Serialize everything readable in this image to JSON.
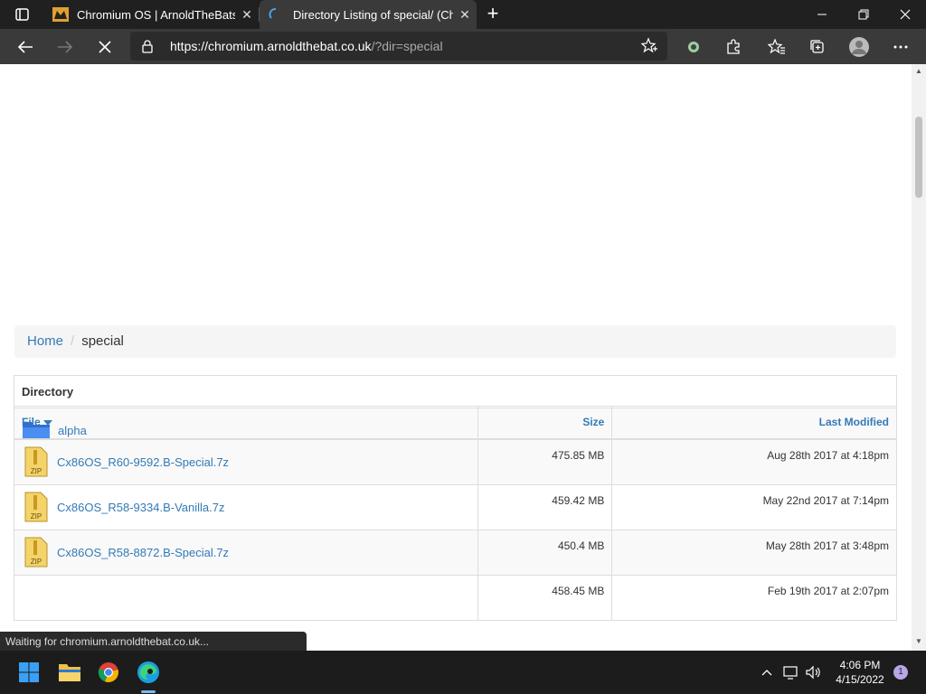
{
  "tabs": [
    {
      "title": "Chromium OS | ArnoldTheBats W",
      "close": "✕"
    },
    {
      "title": "Directory Listing of special/ (Chro",
      "close": "✕"
    }
  ],
  "new_tab": "+",
  "window": {
    "minimize": "—",
    "restore": "❐",
    "close": "✕"
  },
  "address": {
    "host": "https://chromium.arnoldthebat.co.uk",
    "rest": "/?dir=special"
  },
  "breadcrumb": {
    "home": "Home",
    "separator": "/",
    "current": "special"
  },
  "directory": {
    "heading": "Directory",
    "items": [
      {
        "name": "alpha"
      }
    ]
  },
  "files": {
    "headers": {
      "file": "File",
      "size": "Size",
      "modified": "Last Modified"
    },
    "rows": [
      {
        "name": "Cx86OS_R60-9592.B-Special.7z",
        "size": "475.85 MB",
        "modified": "Aug 28th 2017 at 4:18pm"
      },
      {
        "name": "Cx86OS_R58-9334.B-Vanilla.7z",
        "size": "459.42 MB",
        "modified": "May 22nd 2017 at 7:14pm"
      },
      {
        "name": "Cx86OS_R58-8872.B-Special.7z",
        "size": "450.4 MB",
        "modified": "May 28th 2017 at 3:48pm"
      },
      {
        "name": "",
        "size": "458.45 MB",
        "modified": "Feb 19th 2017 at 2:07pm"
      }
    ]
  },
  "status": "Waiting for chromium.arnoldthebat.co.uk...",
  "clock": {
    "time": "4:06 PM",
    "date": "4/15/2022"
  },
  "notification_count": "1",
  "icons": {
    "zip_label": "ZIP"
  },
  "colors": {
    "link": "#337ab7",
    "tab_bg": "#202020",
    "toolbar_bg": "#3a3a3a"
  }
}
